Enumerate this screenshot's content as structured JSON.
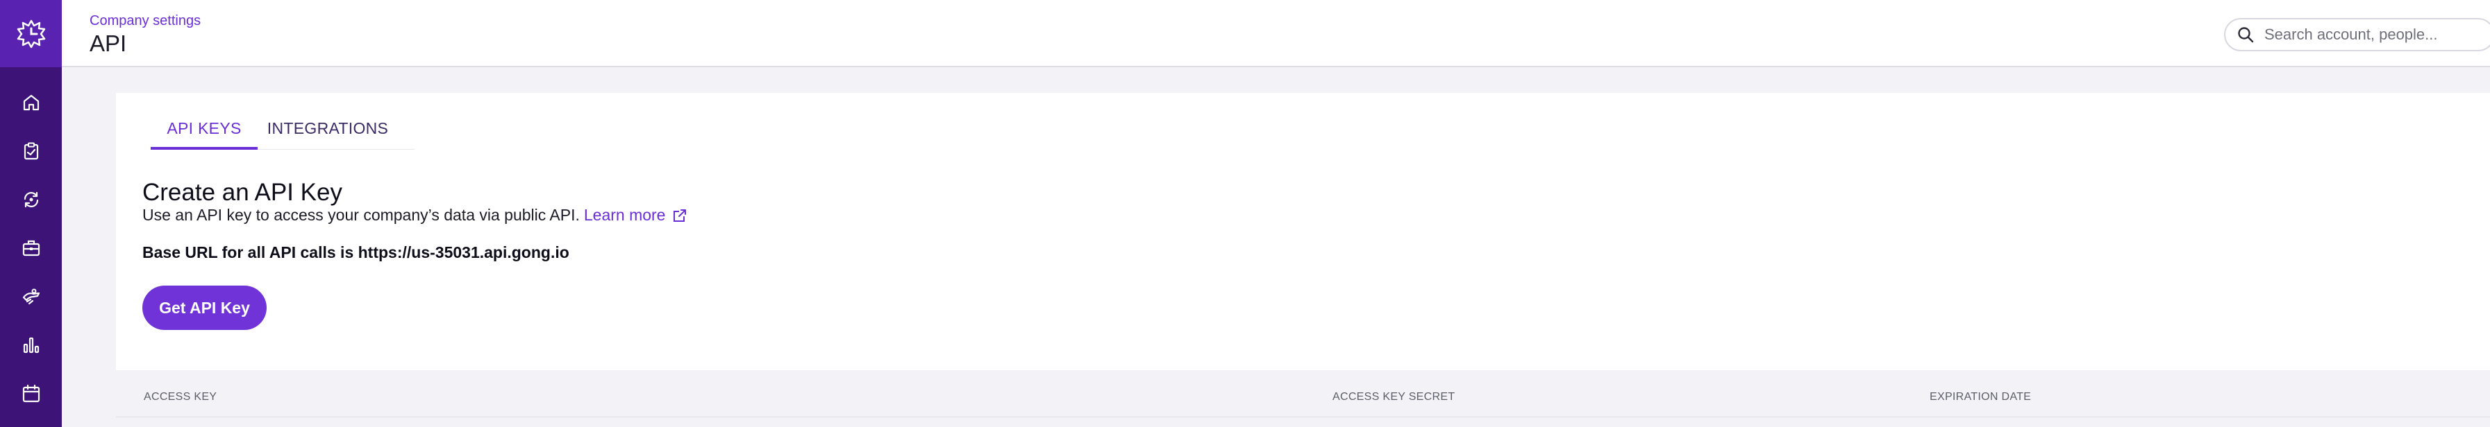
{
  "header": {
    "breadcrumb": "Company settings",
    "title": "API",
    "search_placeholder": "Search account, people..."
  },
  "sidebar": {
    "logo_icon": "gong-logo-icon",
    "items": [
      {
        "icon": "home-icon"
      },
      {
        "icon": "clipboard-check-icon"
      },
      {
        "icon": "refresh-cycle-icon"
      },
      {
        "icon": "briefcase-icon"
      },
      {
        "icon": "coaching-icon"
      },
      {
        "icon": "bar-chart-icon"
      },
      {
        "icon": "calendar-icon"
      }
    ]
  },
  "tabs": [
    {
      "label": "API KEYS",
      "active": true
    },
    {
      "label": "INTEGRATIONS",
      "active": false
    }
  ],
  "main": {
    "section_title": "Create an API Key",
    "description": "Use an API key to access your company’s data via public API.",
    "learn_more": "Learn more",
    "base_url_text": "Base URL for all API calls is https://us-35031.api.gong.io",
    "button_label": "Get API Key"
  },
  "table": {
    "columns": [
      "ACCESS KEY",
      "ACCESS KEY SECRET",
      "EXPIRATION DATE"
    ]
  },
  "colors": {
    "sidebar": "#3d1377",
    "logo_bg": "#5a22b0",
    "accent": "#6a2ed8",
    "button": "#7033d8"
  }
}
